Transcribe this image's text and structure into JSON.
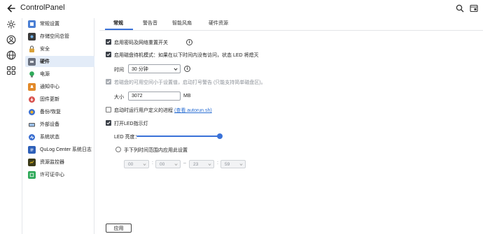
{
  "app": {
    "title": "ControlPanel"
  },
  "colors": {
    "accent": "#3a72d8",
    "active_bg": "#e3ecf8"
  },
  "rail": {
    "icons": [
      "settings-icon",
      "user-circle-icon",
      "globe-icon",
      "apps-grid-icon"
    ]
  },
  "sidebar": {
    "items": [
      {
        "label": "常规设置",
        "icon": "general-settings-icon",
        "color": "#4a7fd4"
      },
      {
        "label": "存储空间总管",
        "icon": "storage-icon",
        "color": "#3a3a3a"
      },
      {
        "label": "安全",
        "icon": "lock-icon",
        "color": "#d9a23a"
      },
      {
        "label": "硬件",
        "icon": "hardware-icon",
        "color": "#6b7280"
      },
      {
        "label": "电源",
        "icon": "power-bulb-icon",
        "color": "#2faa5a"
      },
      {
        "label": "通知中心",
        "icon": "notification-icon",
        "color": "#e28a2b"
      },
      {
        "label": "固件更新",
        "icon": "firmware-update-icon",
        "color": "#d9534f"
      },
      {
        "label": "备份/恢复",
        "icon": "backup-restore-icon",
        "color": "#3b6fd0"
      },
      {
        "label": "外部设备",
        "icon": "external-device-icon",
        "color": "#555"
      },
      {
        "label": "系统状态",
        "icon": "system-status-icon",
        "color": "#3b6fd0"
      },
      {
        "label": "QuLog Center 系统日志",
        "icon": "qulog-icon",
        "color": "#2d5fb8"
      },
      {
        "label": "资源监控器",
        "icon": "resource-monitor-icon",
        "color": "#3a3a1a"
      },
      {
        "label": "许可证中心",
        "icon": "license-icon",
        "color": "#2faa5a"
      }
    ],
    "active_index": 3
  },
  "tabs": [
    {
      "label": "常规"
    },
    {
      "label": "警告音"
    },
    {
      "label": "智能风扇"
    },
    {
      "label": "硬件资源"
    }
  ],
  "settings": {
    "reset_switch": {
      "label": "启用密码及网络重置开关",
      "checked": true
    },
    "disk_standby": {
      "label": "启用磁盘待机模式：如果在以下时间内没有访问，状态 LED 将熄灭",
      "checked": true
    },
    "time_label": "时间",
    "time_value": "30 分钟",
    "low_space": {
      "label": "若磁盘的可用空间小于设置值，启动打号警告 (只能支持简单磁盘区)。",
      "checked": true,
      "disabled": true
    },
    "size_label": "大小",
    "size_value": "3072",
    "size_unit": "MB",
    "user_process": {
      "label": "启动时运行用户定义的进程",
      "link": "(查看 autorun.sh)",
      "checked": false
    },
    "led": {
      "label": "打开LED指示灯",
      "checked": true
    },
    "brightness_label": "LED 亮度：",
    "brightness_level": 1.0,
    "manual_time": {
      "label": "手下列时间范围内应用此设置",
      "checked": false
    },
    "range": {
      "start_h": "00",
      "start_m": "00",
      "end_h": "23",
      "end_m": "59",
      "colon": ":",
      "dash": "–"
    }
  },
  "footer": {
    "apply": "应用"
  }
}
